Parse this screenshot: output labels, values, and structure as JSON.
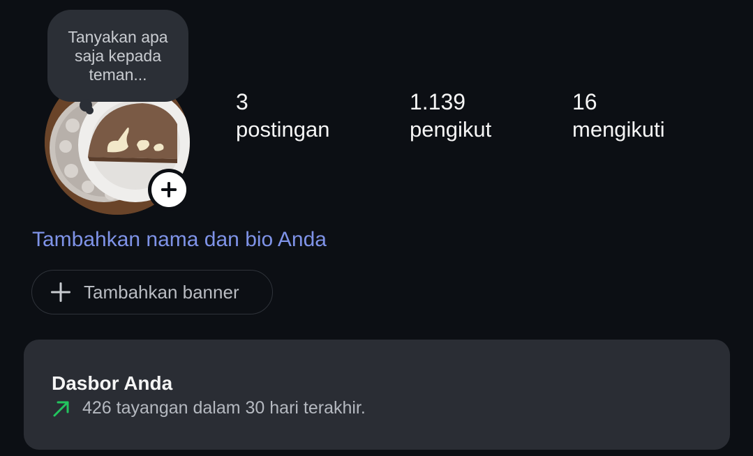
{
  "note": {
    "text": "Tanyakan apa saja kepada teman..."
  },
  "stats": {
    "posts": {
      "count": "3",
      "label": "postingan"
    },
    "followers": {
      "count": "1.139",
      "label": "pengikut"
    },
    "following": {
      "count": "16",
      "label": "mengikuti"
    }
  },
  "profile": {
    "add_name_bio": "Tambahkan nama dan bio Anda",
    "add_banner_label": "Tambahkan banner",
    "avatar_icon": "add-story-plus-icon"
  },
  "dashboard": {
    "title": "Dasbor Anda",
    "views_text": "426 tayangan dalam 30 hari terakhir.",
    "trend_icon": "trend-up-arrow-icon",
    "trend_color": "#22c55e"
  },
  "colors": {
    "background": "#0c0f14",
    "link": "#7f93e8",
    "card": "#2a2d34",
    "bubble": "#2b2f36"
  }
}
